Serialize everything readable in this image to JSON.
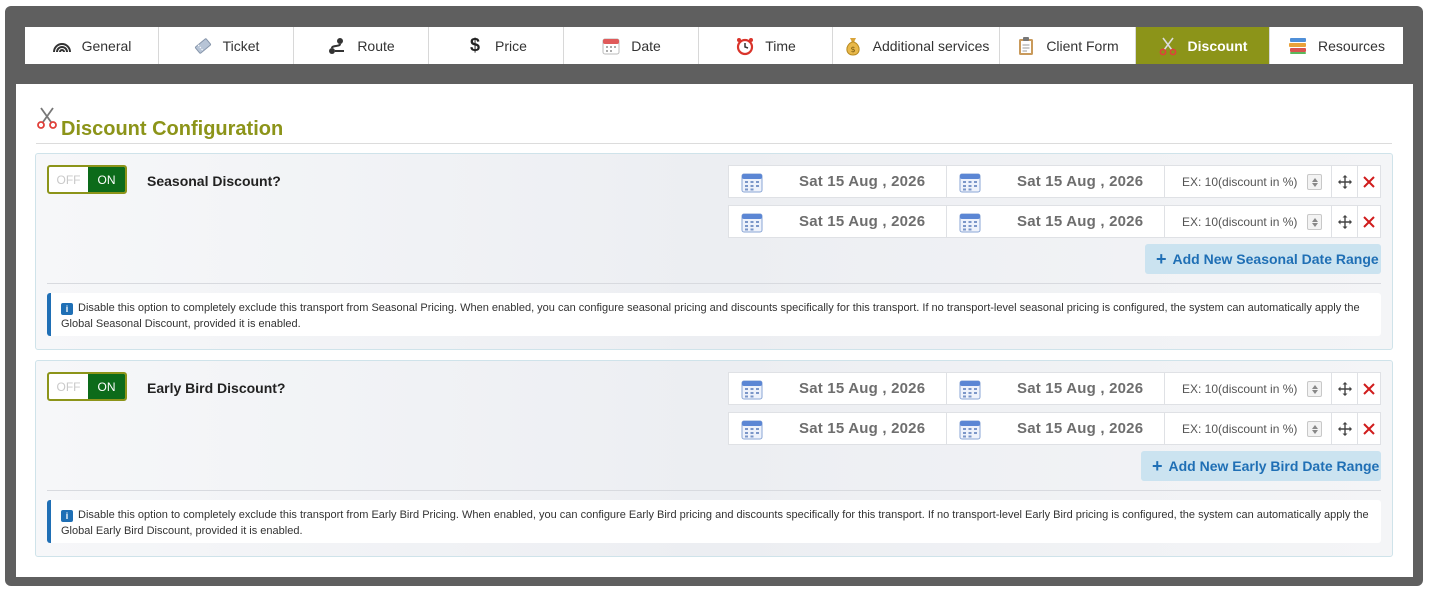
{
  "tabs": [
    {
      "label": "General",
      "icon": "rainbow-icon",
      "width": 134
    },
    {
      "label": "Ticket",
      "icon": "ticket-icon",
      "width": 135
    },
    {
      "label": "Route",
      "icon": "route-icon",
      "width": 135
    },
    {
      "label": "Price",
      "icon": "dollar-icon",
      "width": 135
    },
    {
      "label": "Date",
      "icon": "calendar-icon",
      "width": 135
    },
    {
      "label": "Time",
      "icon": "alarm-clock-icon",
      "width": 134
    },
    {
      "label": "Additional services",
      "icon": "money-bag-icon",
      "width": 167
    },
    {
      "label": "Client Form",
      "icon": "clipboard-icon",
      "width": 136
    },
    {
      "label": "Discount",
      "icon": "scissors-icon",
      "width": 134,
      "active": true
    },
    {
      "label": "Resources",
      "icon": "books-icon",
      "width": 133
    }
  ],
  "page": {
    "title": "Discount Configuration"
  },
  "colors": {
    "accent": "#8c9419",
    "toggle_on": "#0c6b1a",
    "link": "#1f6fb5",
    "remove": "#d01c1c"
  },
  "seasonal": {
    "toggle_off": "OFF",
    "toggle_on": "ON",
    "label": "Seasonal Discount?",
    "rows": [
      {
        "start": "Sat 15 Aug , 2026",
        "end": "Sat 15 Aug , 2026",
        "placeholder": "EX: 10(discount in %)"
      },
      {
        "start": "Sat 15 Aug , 2026",
        "end": "Sat 15 Aug , 2026",
        "placeholder": "EX: 10(discount in %)"
      }
    ],
    "add_label": "Add New Seasonal Date Range",
    "info": "Disable this option to completely exclude this transport from Seasonal Pricing. When enabled, you can configure seasonal pricing and discounts specifically for this transport. If no transport-level seasonal pricing is configured, the system can automatically apply the Global Seasonal Discount, provided it is enabled."
  },
  "earlybird": {
    "toggle_off": "OFF",
    "toggle_on": "ON",
    "label": "Early Bird Discount?",
    "rows": [
      {
        "start": "Sat 15 Aug , 2026",
        "end": "Sat 15 Aug , 2026",
        "placeholder": "EX: 10(discount in %)"
      },
      {
        "start": "Sat 15 Aug , 2026",
        "end": "Sat 15 Aug , 2026",
        "placeholder": "EX: 10(discount in %)"
      }
    ],
    "add_label": "Add New Early Bird Date Range",
    "info": "Disable this option to completely exclude this transport from Early Bird Pricing. When enabled, you can configure Early Bird pricing and discounts specifically for this transport. If no transport-level Early Bird pricing is configured, the system can automatically apply the Global Early Bird Discount, provided it is enabled."
  }
}
